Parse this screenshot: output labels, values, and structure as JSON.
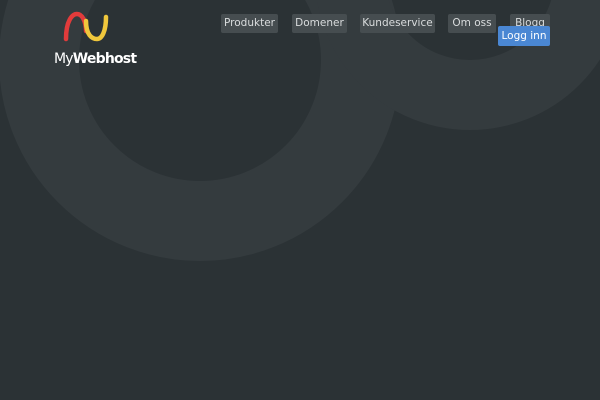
{
  "brand": {
    "name_prefix": "My",
    "name_main": "Webhost",
    "logo_colors": [
      "#e23b3b",
      "#f0c73c"
    ]
  },
  "nav": {
    "items": [
      {
        "label": "Produkter"
      },
      {
        "label": "Domener"
      },
      {
        "label": "Kundeservice"
      },
      {
        "label": "Om oss"
      },
      {
        "label": "Blogg"
      }
    ],
    "login_label": "Logg inn"
  },
  "colors": {
    "background": "#2b3235",
    "nav_button": "#464d50",
    "login_button": "#4a87d3"
  }
}
